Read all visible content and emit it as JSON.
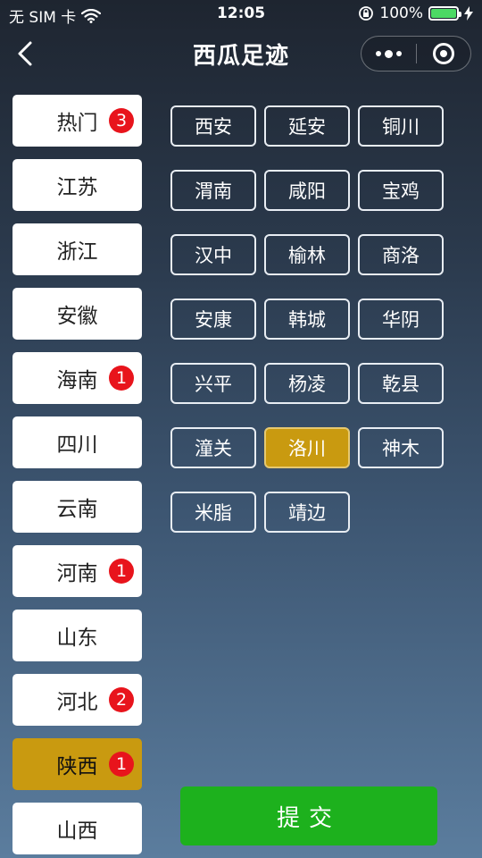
{
  "status_bar": {
    "carrier": "无 SIM 卡",
    "time": "12:05",
    "battery_percent": "100%",
    "battery_level": 1.0
  },
  "nav": {
    "title": "西瓜足迹"
  },
  "provinces": [
    {
      "name": "热门",
      "badge": "3",
      "active": false
    },
    {
      "name": "江苏",
      "badge": "",
      "active": false
    },
    {
      "name": "浙江",
      "badge": "",
      "active": false
    },
    {
      "name": "安徽",
      "badge": "",
      "active": false
    },
    {
      "name": "海南",
      "badge": "1",
      "active": false
    },
    {
      "name": "四川",
      "badge": "",
      "active": false
    },
    {
      "name": "云南",
      "badge": "",
      "active": false
    },
    {
      "name": "河南",
      "badge": "1",
      "active": false
    },
    {
      "name": "山东",
      "badge": "",
      "active": false
    },
    {
      "name": "河北",
      "badge": "2",
      "active": false
    },
    {
      "name": "陕西",
      "badge": "1",
      "active": true
    },
    {
      "name": "山西",
      "badge": "",
      "active": false
    }
  ],
  "cities": [
    {
      "name": "西安",
      "selected": false
    },
    {
      "name": "延安",
      "selected": false
    },
    {
      "name": "铜川",
      "selected": false
    },
    {
      "name": "渭南",
      "selected": false
    },
    {
      "name": "咸阳",
      "selected": false
    },
    {
      "name": "宝鸡",
      "selected": false
    },
    {
      "name": "汉中",
      "selected": false
    },
    {
      "name": "榆林",
      "selected": false
    },
    {
      "name": "商洛",
      "selected": false
    },
    {
      "name": "安康",
      "selected": false
    },
    {
      "name": "韩城",
      "selected": false
    },
    {
      "name": "华阴",
      "selected": false
    },
    {
      "name": "兴平",
      "selected": false
    },
    {
      "name": "杨凌",
      "selected": false
    },
    {
      "name": "乾县",
      "selected": false
    },
    {
      "name": "潼关",
      "selected": false
    },
    {
      "name": "洛川",
      "selected": true
    },
    {
      "name": "神木",
      "selected": false
    },
    {
      "name": "米脂",
      "selected": false
    },
    {
      "name": "靖边",
      "selected": false
    }
  ],
  "submit": {
    "label": "提交"
  },
  "colors": {
    "accent": "#c99a10",
    "badge": "#e8141c",
    "submit": "#1db11d"
  }
}
